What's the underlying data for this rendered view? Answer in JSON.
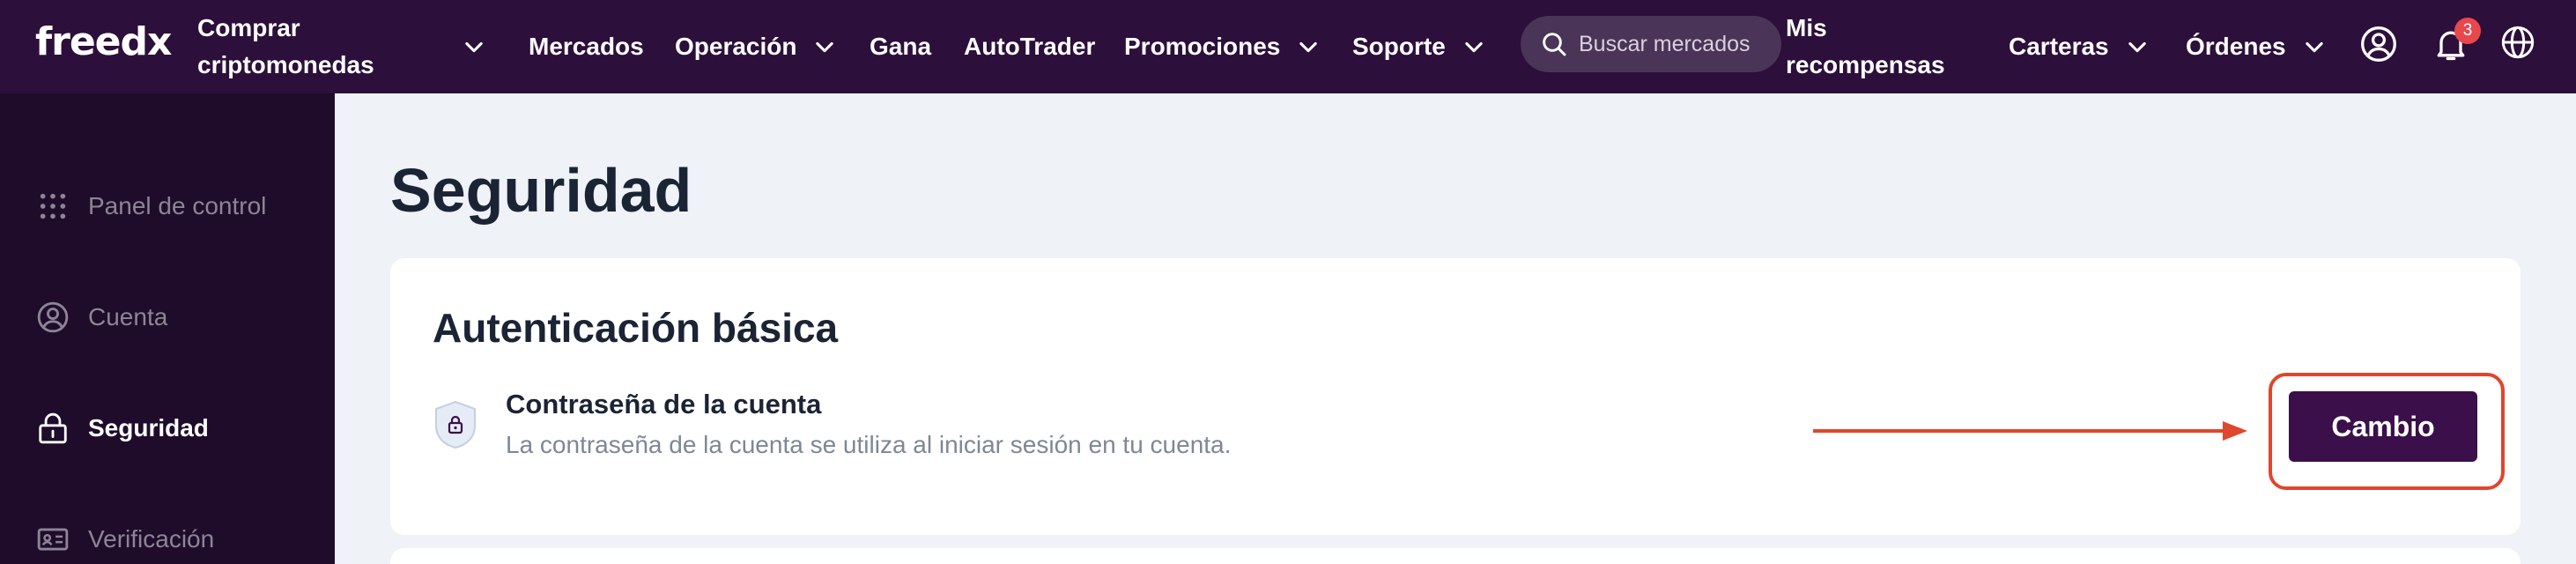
{
  "brand": {
    "logo_text": "freedx",
    "accent": "#3a0f4a",
    "nav_bg": "#2c0f3a",
    "sidebar_bg": "#1f0c2b",
    "highlight": "#e0462d"
  },
  "topnav": {
    "buy_crypto_label": "Comprar criptomonedas",
    "markets_label": "Mercados",
    "trade_label": "Operación",
    "earn_label": "Gana",
    "autotrader_label": "AutoTrader",
    "promotions_label": "Promociones",
    "support_label": "Soporte",
    "search_placeholder": "Buscar mercados",
    "rewards_label": "Mis recompensas",
    "wallets_label": "Carteras",
    "orders_label": "Órdenes",
    "notifications_count": "3",
    "icons": [
      "chevron-down-icon",
      "search-icon",
      "user-icon",
      "bell-icon",
      "globe-icon"
    ]
  },
  "sidebar": {
    "items": [
      {
        "label": "Panel de control",
        "icon": "dashboard-grid-icon",
        "active": false
      },
      {
        "label": "Cuenta",
        "icon": "user-circle-icon",
        "active": false
      },
      {
        "label": "Seguridad",
        "icon": "lock-icon",
        "active": true
      },
      {
        "label": "Verificación",
        "icon": "id-card-icon",
        "active": false
      }
    ]
  },
  "main": {
    "title": "Seguridad",
    "basic_auth": {
      "title": "Autenticación básica",
      "password_title": "Contraseña de la cuenta",
      "password_desc": "La contraseña de la cuenta se utiliza al iniciar sesión en tu cuenta.",
      "change_button": "Cambio"
    }
  }
}
